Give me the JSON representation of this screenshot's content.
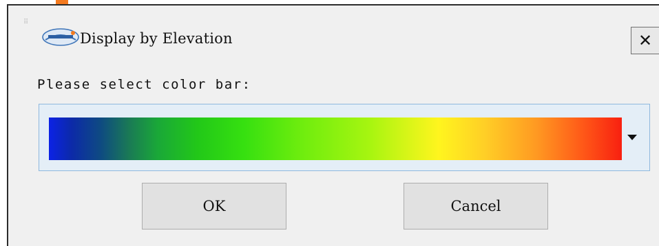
{
  "window": {
    "title": "Display by Elevation",
    "close_label": "✕",
    "logo_icon": "app-logo-icon"
  },
  "content": {
    "prompt": "Please select color bar:",
    "color_bar": {
      "selected": "blue-green-yellow-red",
      "colors": [
        "#0c22e6",
        "#1aa838",
        "#36e010",
        "#a7f510",
        "#fff51e",
        "#ff9a22",
        "#f82010"
      ]
    }
  },
  "buttons": {
    "ok_label": "OK",
    "cancel_label": "Cancel"
  },
  "colors": {
    "accent": "#f47a1f",
    "dialog_bg": "#f0f0f0",
    "combo_border": "#8fb8dd",
    "combo_bg": "#e4eef7"
  }
}
